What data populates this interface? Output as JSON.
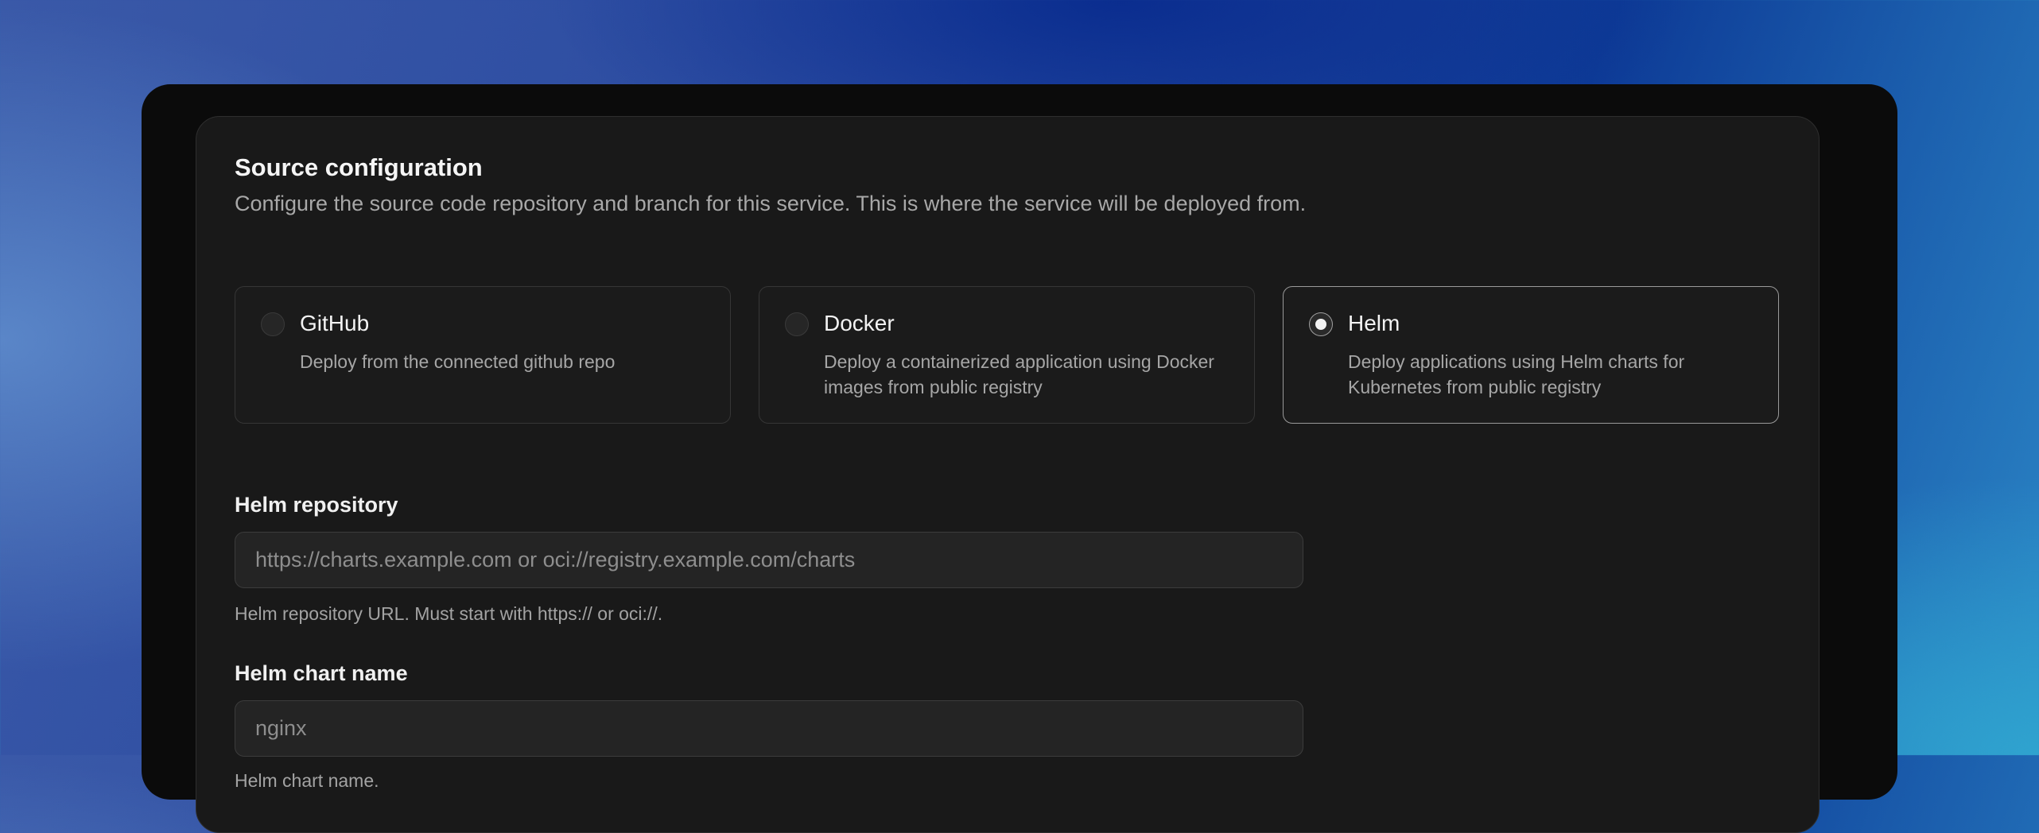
{
  "section": {
    "title": "Source configuration",
    "description": "Configure the source code repository and branch for this service. This is where the service will be deployed from."
  },
  "sources": [
    {
      "title": "GitHub",
      "description": "Deploy from the connected github repo",
      "selected": false
    },
    {
      "title": "Docker",
      "description": "Deploy a containerized application using Docker images from public registry",
      "selected": false
    },
    {
      "title": "Helm",
      "description": "Deploy applications using Helm charts for Kubernetes from public registry",
      "selected": true
    }
  ],
  "helm_repository": {
    "label": "Helm repository",
    "value": "",
    "placeholder": "https://charts.example.com or oci://registry.example.com/charts",
    "help": "Helm repository URL. Must start with https:// or oci://."
  },
  "helm_chart": {
    "label": "Helm chart name",
    "value": "",
    "placeholder": "nginx",
    "help": "Helm chart name."
  }
}
